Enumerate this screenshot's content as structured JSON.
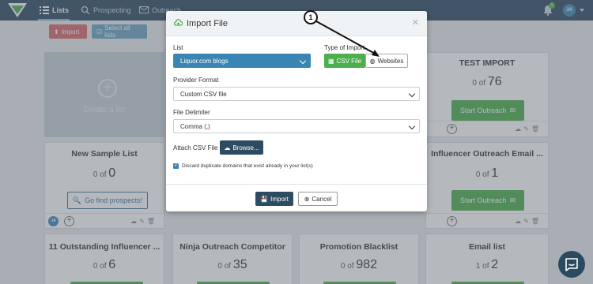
{
  "nav": {
    "items": [
      {
        "label": "Lists",
        "icon": "list-icon",
        "active": true
      },
      {
        "label": "Prospecting",
        "icon": "search-icon",
        "active": false
      },
      {
        "label": "Outreach",
        "icon": "mail-icon",
        "active": false
      }
    ],
    "notification_count": "1",
    "user_initials": "JA"
  },
  "toolbar": {
    "import_label": "Import",
    "select_all_label": "Select all lists"
  },
  "cards": {
    "create_label": "Create a list",
    "test_import": {
      "title": "TEST IMPORT",
      "of": "0 of",
      "total": "76",
      "button": "Start Outreach"
    },
    "new_sample": {
      "title": "New Sample List",
      "of": "0 of",
      "total": "0",
      "button": "Go find prospects!"
    },
    "influencer": {
      "title": "Influencer Outreach Email ...",
      "of": "0 of",
      "total": "1",
      "button": "Start Outreach"
    },
    "outstanding": {
      "title": "11 Outstanding Influencer ...",
      "of": "0 of",
      "total": "6"
    },
    "ninja": {
      "title": "Ninja Outreach Competitor",
      "of": "0 of",
      "total": "35"
    },
    "blacklist": {
      "title": "Promotion Blacklist",
      "of": "0 of",
      "total": "982"
    },
    "email_list": {
      "title": "Email list",
      "of": "1 of",
      "total": "2"
    }
  },
  "modal": {
    "title": "Import File",
    "list_label": "List",
    "list_value": "Liquor.com blogs",
    "type_label": "Type of Import",
    "type_csv": "CSV File",
    "type_web": "Websites",
    "provider_label": "Provider Format",
    "provider_value": "Custom CSV file",
    "delimiter_label": "File Delimiter",
    "delimiter_value": "Comma (,)",
    "attach_label": "Attach CSV File",
    "browse_label": "Browse...",
    "discard_label": "Discard duplicate domains that exist already in your list(s)",
    "discard_checked": true,
    "import_button": "Import",
    "cancel_button": "Cancel"
  },
  "annotation": {
    "number": "1"
  },
  "colors": {
    "nav_bg": "#2c4a5f",
    "accent_green": "#4cae4c",
    "accent_blue": "#3b85b3",
    "danger": "#d96767"
  }
}
